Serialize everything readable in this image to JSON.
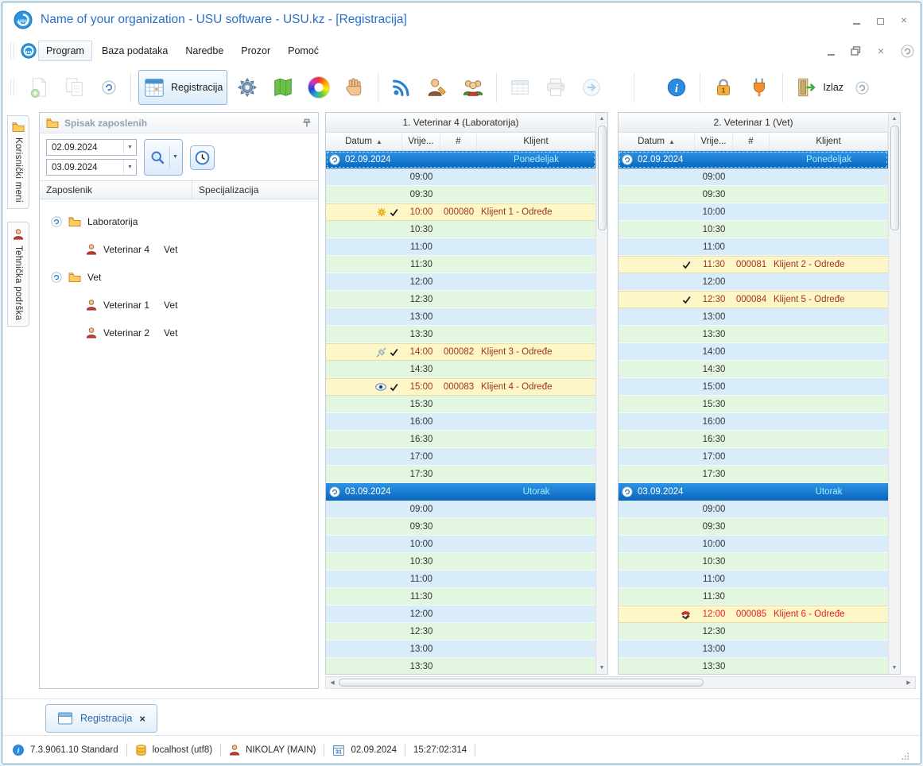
{
  "window": {
    "title": "Name of your organization - USU software - USU.kz - [Registracija]"
  },
  "menubar": {
    "items": [
      {
        "label": "Program"
      },
      {
        "label": "Baza podataka"
      },
      {
        "label": "Naredbe"
      },
      {
        "label": "Prozor"
      },
      {
        "label": "Pomoć"
      }
    ]
  },
  "toolbar": {
    "registration_button": "Registracija",
    "exit_button": "Izlaz"
  },
  "side_tabs": [
    {
      "label": "Korisnički meni",
      "icon": "folder"
    },
    {
      "label": "Tehnička podrška",
      "icon": "person"
    }
  ],
  "employees_panel": {
    "title": "Spisak zaposlenih",
    "date_from": "02.09.2024",
    "date_to": "03.09.2024",
    "columns": {
      "employee": "Zaposlenik",
      "specialization": "Specijalizacija"
    },
    "tree": [
      {
        "kind": "group",
        "label": "Laboratorija"
      },
      {
        "kind": "employee",
        "name": "Veterinar 4",
        "spec": "Vet"
      },
      {
        "kind": "group",
        "label": "Vet"
      },
      {
        "kind": "employee",
        "name": "Veterinar 1",
        "spec": "Vet"
      },
      {
        "kind": "employee",
        "name": "Veterinar 2",
        "spec": "Vet"
      }
    ]
  },
  "schedule": {
    "columns": {
      "date": "Datum",
      "time": "Vrije...",
      "number": "#",
      "client": "Klijent"
    },
    "colors": {
      "row_blue": "#d9ecf9",
      "row_green": "#e2f6e0",
      "appointment_bg": "#fdf6c8",
      "appointment_text": "#a03818",
      "appointment_text_red": "#e02424",
      "day_header_bg": "#2d93e6",
      "day_header_text": "#ffffff",
      "day_name_text": "#a5f1ff"
    },
    "panels": [
      {
        "title": "1. Veterinar 4 (Laboratorija)",
        "days": [
          {
            "date": "02.09.2024",
            "day_name": "Ponedeljak",
            "slots": [
              {
                "time": "09:00"
              },
              {
                "time": "09:30"
              },
              {
                "time": "10:00",
                "appt": {
                  "icons": [
                    "star",
                    "check"
                  ],
                  "number": "000080",
                  "client": "Klijent 1 - Određe"
                }
              },
              {
                "time": "10:30"
              },
              {
                "time": "11:00"
              },
              {
                "time": "11:30"
              },
              {
                "time": "12:00"
              },
              {
                "time": "12:30"
              },
              {
                "time": "13:00"
              },
              {
                "time": "13:30"
              },
              {
                "time": "14:00",
                "appt": {
                  "icons": [
                    "syringe",
                    "check"
                  ],
                  "number": "000082",
                  "client": "Klijent 3 - Određe"
                }
              },
              {
                "time": "14:30"
              },
              {
                "time": "15:00",
                "appt": {
                  "icons": [
                    "eye",
                    "check"
                  ],
                  "number": "000083",
                  "client": "Klijent 4 - Određe"
                }
              },
              {
                "time": "15:30"
              },
              {
                "time": "16:00"
              },
              {
                "time": "16:30"
              },
              {
                "time": "17:00"
              },
              {
                "time": "17:30"
              }
            ]
          },
          {
            "date": "03.09.2024",
            "day_name": "Utorak",
            "slots": [
              {
                "time": "09:00"
              },
              {
                "time": "09:30"
              },
              {
                "time": "10:00"
              },
              {
                "time": "10:30"
              },
              {
                "time": "11:00"
              },
              {
                "time": "11:30"
              },
              {
                "time": "12:00"
              },
              {
                "time": "12:30"
              },
              {
                "time": "13:00"
              },
              {
                "time": "13:30"
              }
            ]
          }
        ]
      },
      {
        "title": "2. Veterinar 1 (Vet)",
        "days": [
          {
            "date": "02.09.2024",
            "day_name": "Ponedeljak",
            "slots": [
              {
                "time": "09:00"
              },
              {
                "time": "09:30"
              },
              {
                "time": "10:00"
              },
              {
                "time": "10:30"
              },
              {
                "time": "11:00"
              },
              {
                "time": "11:30",
                "appt": {
                  "icons": [
                    "check"
                  ],
                  "number": "000081",
                  "client": "Klijent 2 - Određe"
                }
              },
              {
                "time": "12:00"
              },
              {
                "time": "12:30",
                "appt": {
                  "icons": [
                    "check"
                  ],
                  "number": "000084",
                  "client": "Klijent 5 - Određe"
                }
              },
              {
                "time": "13:00"
              },
              {
                "time": "13:30"
              },
              {
                "time": "14:00"
              },
              {
                "time": "14:30"
              },
              {
                "time": "15:00"
              },
              {
                "time": "15:30"
              },
              {
                "time": "16:00"
              },
              {
                "time": "16:30"
              },
              {
                "time": "17:00"
              },
              {
                "time": "17:30"
              }
            ]
          },
          {
            "date": "03.09.2024",
            "day_name": "Utorak",
            "slots": [
              {
                "time": "09:00"
              },
              {
                "time": "09:30"
              },
              {
                "time": "10:00"
              },
              {
                "time": "10:30"
              },
              {
                "time": "11:00"
              },
              {
                "time": "11:30"
              },
              {
                "time": "12:00",
                "appt": {
                  "icons": [
                    "phone"
                  ],
                  "number": "000085",
                  "client": "Klijent 6 - Određe",
                  "red": true
                }
              },
              {
                "time": "12:30"
              },
              {
                "time": "13:00"
              },
              {
                "time": "13:30"
              }
            ]
          }
        ]
      }
    ]
  },
  "doc_tabs": [
    {
      "label": "Registracija"
    }
  ],
  "statusbar": {
    "version": "7.3.9061.10 Standard",
    "database": "localhost (utf8)",
    "user": "NIKOLAY (MAIN)",
    "date": "02.09.2024",
    "time": "15:27:02:314",
    "calendar_day": "31"
  }
}
